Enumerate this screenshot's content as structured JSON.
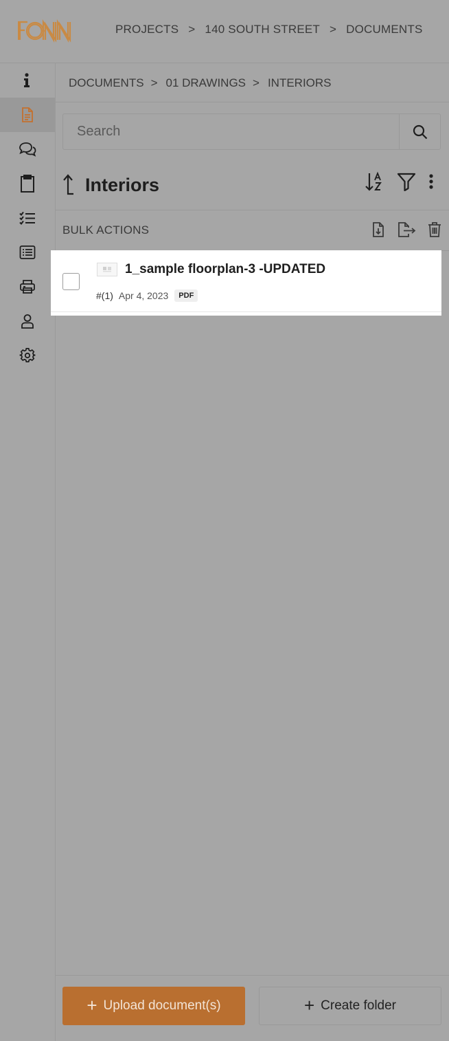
{
  "brand": {
    "name": "FONN",
    "accent": "#b96f30"
  },
  "header": {
    "breadcrumbs": [
      "PROJECTS",
      "140 SOUTH STREET",
      "DOCUMENTS"
    ],
    "separator": ">"
  },
  "sidebar": {
    "items": [
      {
        "icon": "info-icon",
        "active": false
      },
      {
        "icon": "document-icon",
        "active": true
      },
      {
        "icon": "chat-icon",
        "active": false
      },
      {
        "icon": "clipboard-icon",
        "active": false
      },
      {
        "icon": "checklist-icon",
        "active": false
      },
      {
        "icon": "list-icon",
        "active": false
      },
      {
        "icon": "printer-icon",
        "active": false
      },
      {
        "icon": "user-icon",
        "active": false
      },
      {
        "icon": "gear-icon",
        "active": false
      }
    ]
  },
  "documents": {
    "breadcrumbs": [
      "DOCUMENTS",
      "01 DRAWINGS",
      "INTERIORS"
    ],
    "separator": ">",
    "search": {
      "placeholder": "Search"
    },
    "folder_title": "Interiors",
    "bulk_actions_label": "BULK ACTIONS",
    "items": [
      {
        "name": "1_sample floorplan-3 -UPDATED",
        "revision": "#(1)",
        "date": "Apr 4, 2023",
        "type": "PDF"
      }
    ]
  },
  "footer": {
    "upload_label": "Upload document(s)",
    "create_folder_label": "Create folder",
    "plus": "+"
  }
}
